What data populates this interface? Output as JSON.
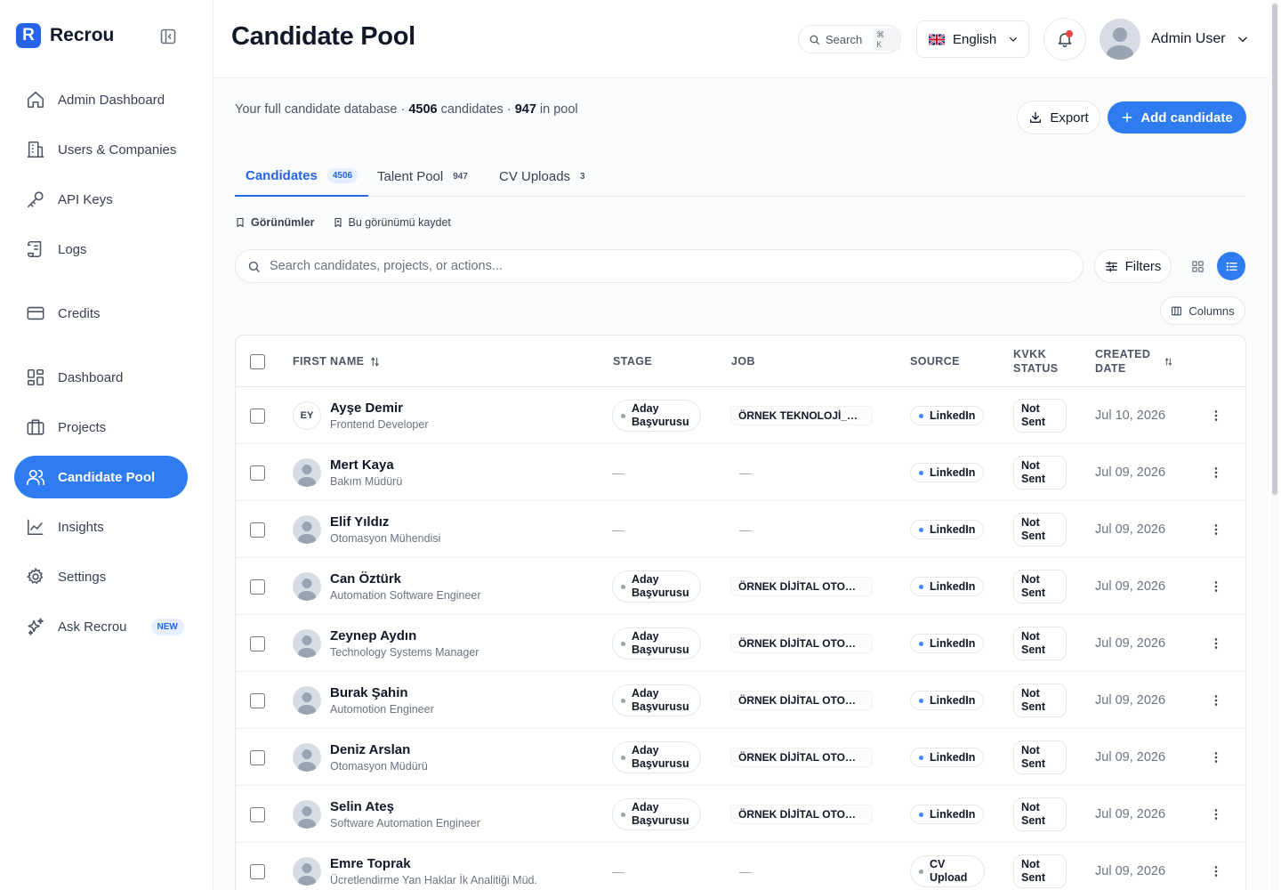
{
  "app": {
    "name": "Recrou",
    "logo_letter": "R"
  },
  "sidebar": {
    "items": [
      {
        "label": "Admin Dashboard",
        "icon": "home-icon"
      },
      {
        "label": "Users & Companies",
        "icon": "building-icon"
      },
      {
        "label": "API Keys",
        "icon": "key-icon"
      },
      {
        "label": "Logs",
        "icon": "scroll-icon"
      },
      {
        "label": "Credits",
        "icon": "credit-card-icon"
      },
      {
        "label": "Dashboard",
        "icon": "grid-icon"
      },
      {
        "label": "Projects",
        "icon": "briefcase-icon"
      },
      {
        "label": "Candidate Pool",
        "icon": "users-icon",
        "active": true
      },
      {
        "label": "Insights",
        "icon": "line-chart-icon"
      },
      {
        "label": "Settings",
        "icon": "gear-icon"
      },
      {
        "label": "Ask Recrou",
        "icon": "sparkle-icon",
        "badge": "NEW"
      }
    ]
  },
  "header": {
    "title": "Candidate Pool",
    "search_label": "Search",
    "search_shortcut": "⌘ K",
    "language": "English",
    "user_name": "Admin User"
  },
  "summary": {
    "prefix": "Your full candidate database ·",
    "candidates": "4506",
    "candidates_label": "candidates ·",
    "pool": "947",
    "pool_label": "in pool"
  },
  "actions": {
    "export": "Export",
    "add": "Add candidate"
  },
  "tabs": [
    {
      "label": "Candidates",
      "count": "4506",
      "active": true
    },
    {
      "label": "Talent Pool",
      "count": "947"
    },
    {
      "label": "CV Uploads",
      "count": "3"
    }
  ],
  "views": {
    "saved_views": "Görünümler",
    "save_view": "Bu görünümü kaydet"
  },
  "toolbar": {
    "search_placeholder": "Search candidates, projects, or actions...",
    "filters": "Filters",
    "columns": "Columns"
  },
  "table": {
    "columns": {
      "first_name": "FIRST NAME",
      "stage": "STAGE",
      "job": "JOB",
      "source": "SOURCE",
      "kvkk_line1": "KVKK",
      "kvkk_line2": "STATUS",
      "created_line1": "CREATED",
      "created_line2": "DATE"
    },
    "rows": [
      {
        "initials": "EY",
        "name": "Ayşe Demir",
        "role": "Frontend Developer",
        "stage1": "Aday",
        "stage2": "Başvurusu",
        "job": "ÖRNEK TEKNOLOJİ_Web...",
        "source1": "LinkedIn",
        "source2": "",
        "kvkk1": "Not",
        "kvkk2": "Sent",
        "date": "Jul 10, 2026"
      },
      {
        "initials": "",
        "name": "Mert Kaya",
        "role": "Bakım Müdürü",
        "stage1": "",
        "stage2": "",
        "job": "",
        "source1": "LinkedIn",
        "source2": "",
        "kvkk1": "Not",
        "kvkk2": "Sent",
        "date": "Jul 09, 2026"
      },
      {
        "initials": "",
        "name": "Elif Yıldız",
        "role": "Otomasyon Mühendisi",
        "stage1": "",
        "stage2": "",
        "job": "",
        "source1": "LinkedIn",
        "source2": "",
        "kvkk1": "Not",
        "kvkk2": "Sent",
        "date": "Jul 09, 2026"
      },
      {
        "initials": "",
        "name": "Can Öztürk",
        "role": "Automation Software Engineer",
        "stage1": "Aday",
        "stage2": "Başvurusu",
        "job": "ÖRNEK DİJİTAL OTOMAS...",
        "source1": "LinkedIn",
        "source2": "",
        "kvkk1": "Not",
        "kvkk2": "Sent",
        "date": "Jul 09, 2026"
      },
      {
        "initials": "",
        "name": "Zeynep Aydın",
        "role": "Technology Systems Manager",
        "stage1": "Aday",
        "stage2": "Başvurusu",
        "job": "ÖRNEK DİJİTAL OTOMAS...",
        "source1": "LinkedIn",
        "source2": "",
        "kvkk1": "Not",
        "kvkk2": "Sent",
        "date": "Jul 09, 2026"
      },
      {
        "initials": "",
        "name": "Burak Şahin",
        "role": "Automotion Engineer",
        "stage1": "Aday",
        "stage2": "Başvurusu",
        "job": "ÖRNEK DİJİTAL OTOMAS...",
        "source1": "LinkedIn",
        "source2": "",
        "kvkk1": "Not",
        "kvkk2": "Sent",
        "date": "Jul 09, 2026"
      },
      {
        "initials": "",
        "name": "Deniz Arslan",
        "role": "Otomasyon Müdürü",
        "stage1": "Aday",
        "stage2": "Başvurusu",
        "job": "ÖRNEK DİJİTAL OTOMAS...",
        "source1": "LinkedIn",
        "source2": "",
        "kvkk1": "Not",
        "kvkk2": "Sent",
        "date": "Jul 09, 2026"
      },
      {
        "initials": "",
        "name": "Selin Ateş",
        "role": "Software Automation Engineer",
        "stage1": "Aday",
        "stage2": "Başvurusu",
        "job": "ÖRNEK DİJİTAL OTOMAS...",
        "source1": "LinkedIn",
        "source2": "",
        "kvkk1": "Not",
        "kvkk2": "Sent",
        "date": "Jul 09, 2026"
      },
      {
        "initials": "",
        "name": "Emre Toprak",
        "role": "Ücretlendirme Yan Haklar İk Analitiği Müd.",
        "stage1": "",
        "stage2": "",
        "job": "",
        "source1": "CV",
        "source2": "Upload",
        "kvkk1": "Not",
        "kvkk2": "Sent",
        "date": "Jul 09, 2026"
      }
    ]
  },
  "empty_value": "—",
  "colors": {
    "accent": "#2f7bf1",
    "notification": "#ef4444",
    "linkedin_dot": "#3b82f6"
  }
}
